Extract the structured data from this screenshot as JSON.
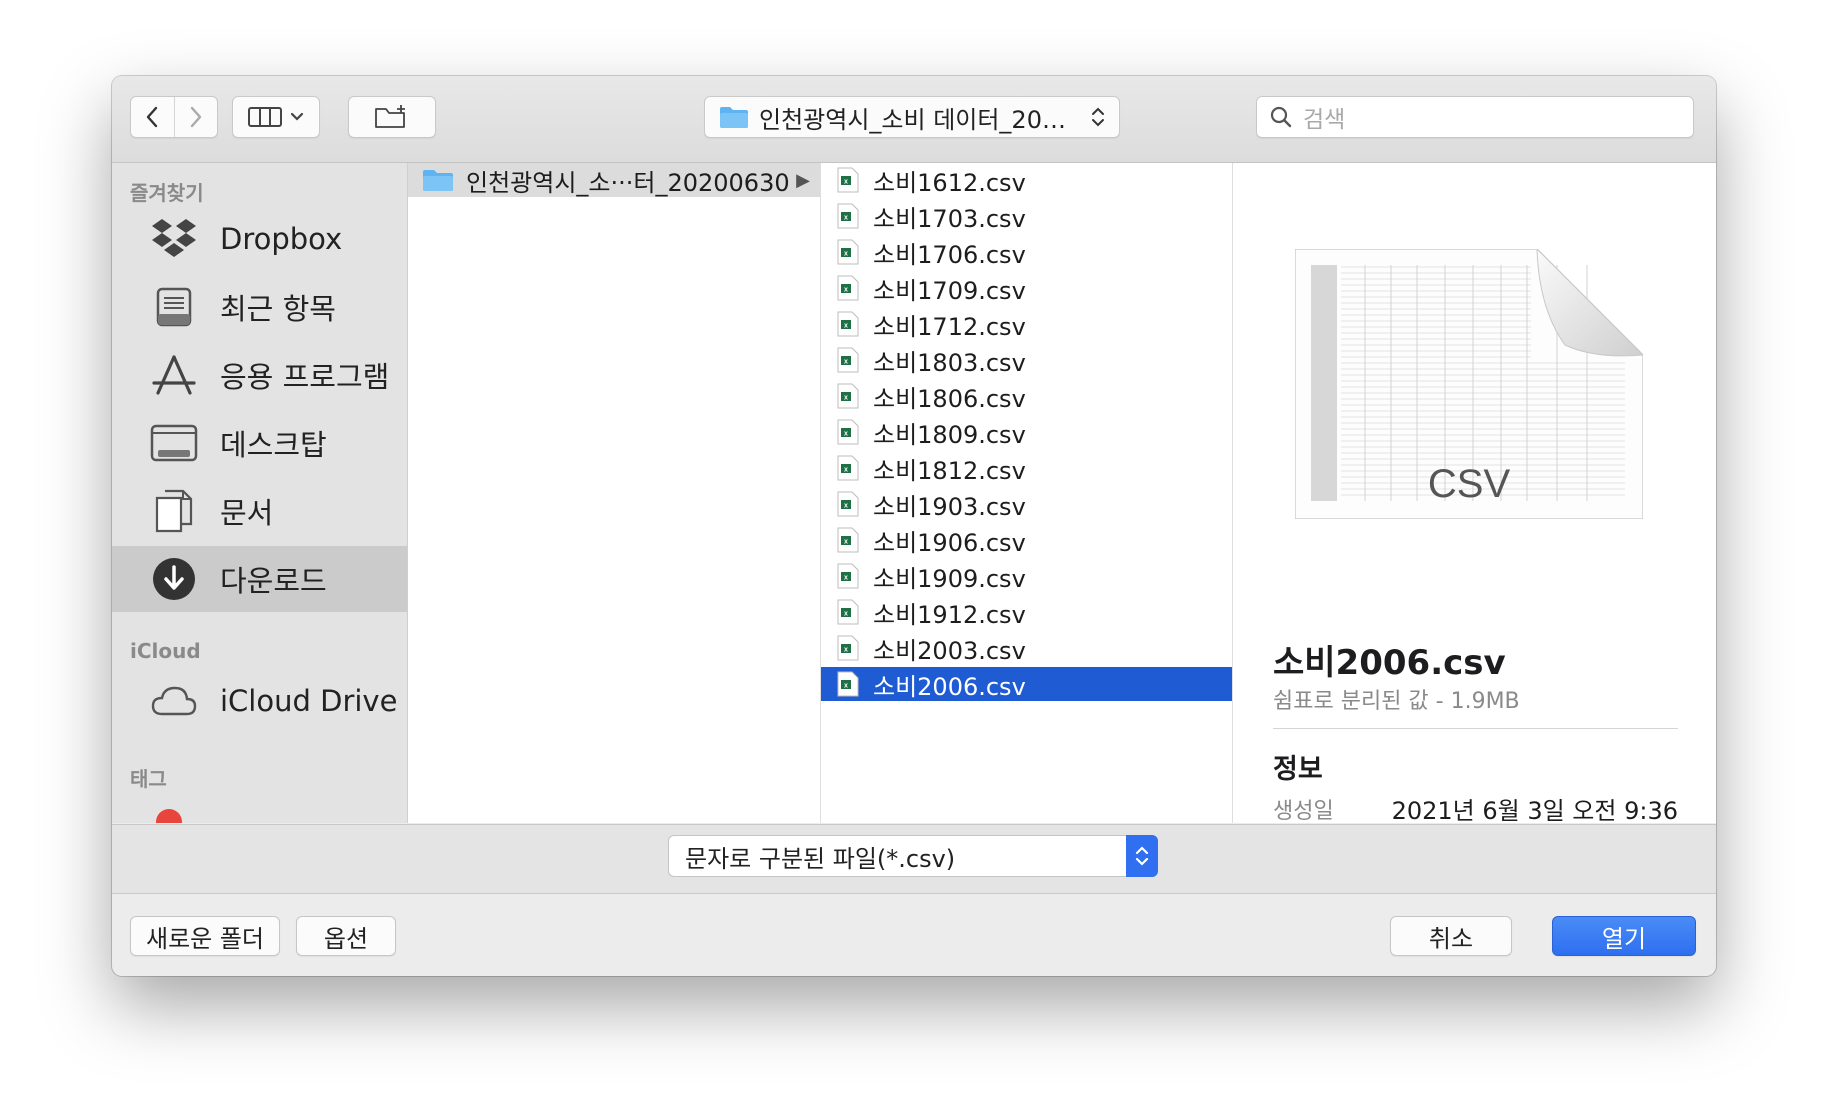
{
  "toolbar": {
    "path_label": "인천광역시_소비 데이터_2020...",
    "search_placeholder": "검색"
  },
  "sidebar": {
    "favorites_header": "즐겨찾기",
    "favorites": [
      {
        "label": "Dropbox",
        "icon": "dropbox-icon"
      },
      {
        "label": "최근 항목",
        "icon": "recents-icon"
      },
      {
        "label": "응용 프로그램",
        "icon": "applications-icon"
      },
      {
        "label": "데스크탑",
        "icon": "desktop-icon"
      },
      {
        "label": "문서",
        "icon": "documents-icon"
      },
      {
        "label": "다운로드",
        "icon": "downloads-icon",
        "selected": true
      }
    ],
    "icloud_header": "iCloud",
    "icloud": [
      {
        "label": "iCloud Drive",
        "icon": "cloud-icon"
      }
    ],
    "tags_header": "태그"
  },
  "column1": {
    "folder": "인천광역시_소···터_20200630"
  },
  "column2": {
    "files": [
      "소비1612.csv",
      "소비1703.csv",
      "소비1706.csv",
      "소비1709.csv",
      "소비1712.csv",
      "소비1803.csv",
      "소비1806.csv",
      "소비1809.csv",
      "소비1812.csv",
      "소비1903.csv",
      "소비1906.csv",
      "소비1909.csv",
      "소비1912.csv",
      "소비2003.csv",
      "소비2006.csv"
    ],
    "selected_index": 14
  },
  "preview": {
    "thumb_label": "CSV",
    "name": "소비2006.csv",
    "kind": "쉼표로 분리된 값 - 1.9MB",
    "info_header": "정보",
    "created_key": "생성일",
    "created_value": "2021년 6월 3일 오전 9:36"
  },
  "format": {
    "selected": "문자로 구분된 파일(*.csv)"
  },
  "buttons": {
    "new_folder": "새로운 폴더",
    "options": "옵션",
    "cancel": "취소",
    "open": "열기"
  },
  "colors": {
    "selection": "#1f5bd3",
    "primary_button": "#2e6ff0"
  }
}
